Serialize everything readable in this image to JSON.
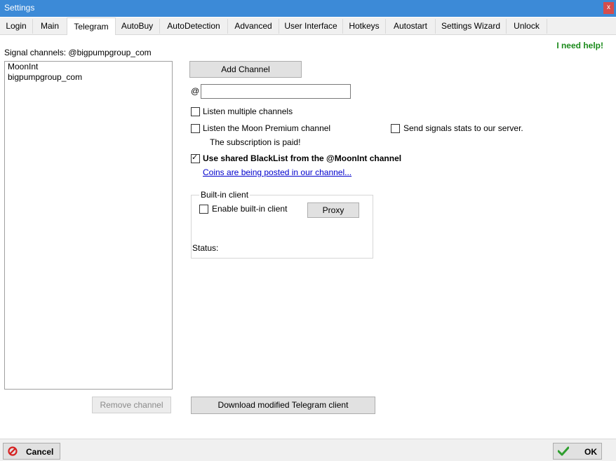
{
  "window": {
    "title": "Settings",
    "close_glyph": "x"
  },
  "tabs": [
    {
      "label": "Login"
    },
    {
      "label": "Main"
    },
    {
      "label": "Telegram"
    },
    {
      "label": "AutoBuy"
    },
    {
      "label": "AutoDetection"
    },
    {
      "label": "Advanced"
    },
    {
      "label": "User Interface"
    },
    {
      "label": "Hotkeys"
    },
    {
      "label": "Autostart"
    },
    {
      "label": "Settings Wizard"
    },
    {
      "label": "Unlock"
    }
  ],
  "active_tab": "Telegram",
  "telegram": {
    "help_link": "I need help!",
    "signal_channels_label": "Signal channels:",
    "signal_channels_value": "@bigpumpgroup_com",
    "channels": [
      "MoonInt",
      "bigpumpgroup_com"
    ],
    "add_channel_button": "Add Channel",
    "at_sign": "@",
    "channel_input_value": "",
    "listen_multiple": {
      "label": "Listen multiple channels",
      "checked": false
    },
    "listen_premium": {
      "label": "Listen the Moon Premium channel",
      "checked": false
    },
    "subscription_status": "The subscription is paid!",
    "send_stats": {
      "label": "Send signals stats to our server.",
      "checked": false
    },
    "shared_blacklist": {
      "label": "Use shared BlackList from the @MoonInt channel",
      "checked": true
    },
    "coins_link": "Coins are being posted in our channel...",
    "builtin_client": {
      "group_title": "Built-in client",
      "enable": {
        "label": "Enable built-in client",
        "checked": false
      },
      "proxy_button": "Proxy",
      "status_label": "Status:"
    },
    "remove_channel_button": "Remove channel",
    "download_button": "Download modified Telegram client"
  },
  "footer": {
    "cancel_label": "Cancel",
    "ok_label": "OK"
  },
  "colors": {
    "titlebar": "#3c8ad7",
    "close": "#d54d4d",
    "help": "#1a8a1a",
    "link": "#0000cc"
  }
}
